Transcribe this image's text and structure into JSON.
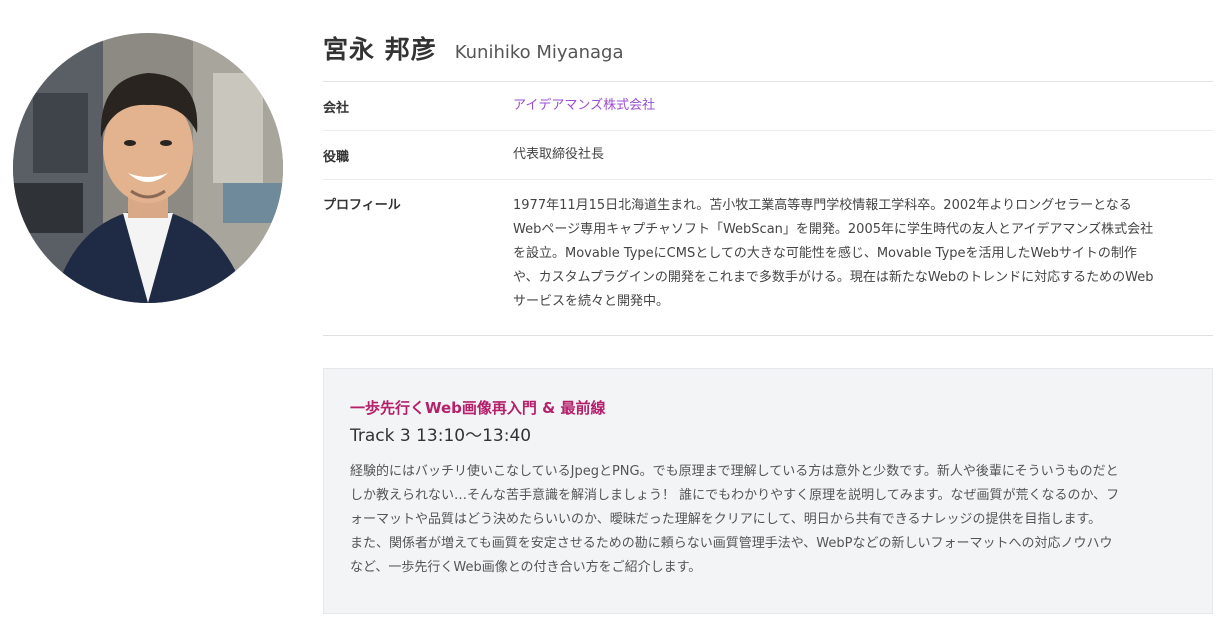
{
  "speaker": {
    "name_ja": "宮永 邦彦",
    "name_en": "Kunihiko Miyanaga",
    "photo": "speaker-portrait"
  },
  "info": {
    "company_label": "会社",
    "company_value": "アイデアマンズ株式会社",
    "position_label": "役職",
    "position_value": "代表取締役社長",
    "profile_label": "プロフィール",
    "profile_value": "1977年11月15日北海道生まれ。苫小牧工業高等専門学校情報工学科卒。2002年よりロングセラーとなる\nWebページ専用キャプチャソフト「WebScan」を開発。2005年に学生時代の友人とアイデアマンズ株式会社\nを設立。Movable TypeにCMSとしての大きな可能性を感じ、Movable Typeを活用したWebサイトの制作\nや、カスタムプラグインの開発をこれまで多数手がける。現在は新たなWebのトレンドに対応するためのWeb\nサービスを続々と開発中。"
  },
  "session": {
    "title": "一歩先行くWeb画像再入門 & 最前線",
    "time": "Track 3 13:10〜13:40",
    "description": "経験的にはバッチリ使いこなしているJpegとPNG。でも原理まで理解している方は意外と少数です。新人や後輩にそういうものだと\nしか教えられない…そんな苦手意識を解消しましょう！ 誰にでもわかりやすく原理を説明してみます。なぜ画質が荒くなるのか、フ\nォーマットや品質はどう決めたらいいのか、曖昧だった理解をクリアにして、明日から共有できるナレッジの提供を目指します。\nまた、関係者が増えても画質を安定させるための勘に頼らない画質管理手法や、WebPなどの新しいフォーマットへの対応ノウハウ\nなど、一歩先行くWeb画像との付き合い方をご紹介します。"
  },
  "colors": {
    "link": "#9b4fcf",
    "session_title": "#b5206b",
    "session_bg": "#f3f4f6"
  }
}
